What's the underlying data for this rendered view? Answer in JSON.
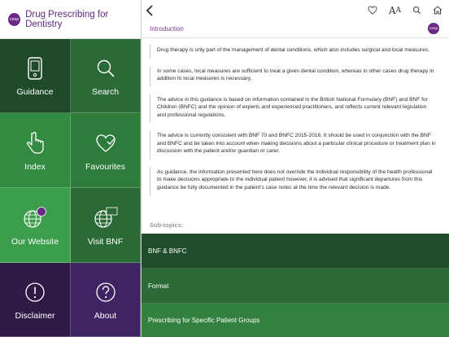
{
  "app": {
    "logo_text": "cesp",
    "title": "Drug Prescribing for Dentistry"
  },
  "tiles": [
    {
      "label": "Guidance",
      "icon": "phone-icon"
    },
    {
      "label": "Search",
      "icon": "search-icon"
    },
    {
      "label": "Index",
      "icon": "pointing-hand-icon"
    },
    {
      "label": "Favourites",
      "icon": "heart-icon"
    },
    {
      "label": "Our Website",
      "icon": "globe-icon"
    },
    {
      "label": "Visit BNF",
      "icon": "bnf-globe-icon"
    },
    {
      "label": "Disclaimer",
      "icon": "exclamation-icon"
    },
    {
      "label": "About",
      "icon": "question-icon"
    }
  ],
  "toolbar": {
    "font_size_big": "A",
    "font_size_small": "A"
  },
  "section": {
    "title": "Introduction",
    "logo_text": "cesp"
  },
  "paragraphs": [
    "Drug therapy is only part of the management of dental conditions, which also includes surgical and local measures.",
    "In some cases, local measures are sufficient to treat a given dental condition, whereas in other cases drug therapy in addition to local measures is necessary.",
    "The advice in this guidance is based on information contained in the British National Formulary (BNF) and BNF for Children (BNFC) and the opinion of experts and experienced practitioners, and reflects current relevant legislation and professional regulations.",
    "The advice is currently consistent with BNF 70 and BNFC 2015-2016. It should be used in conjunction with the BNF and BNFC and be taken into account when making decisions about a particular clinical procedure or treatment plan in discussion with the patient and/or guardian or carer.",
    "As guidance, the information presented here does not override the individual responsibility of the health professional to make decisions appropriate to the individual patient however, it is advised that significant departures from this guidance be fully documented in the patient's case notes at the time the relevant decision is made."
  ],
  "subtopics": {
    "label": "Sub-topics:",
    "items": [
      "BNF & BNFC",
      "Format",
      "Prescribing for Specific Patient Groups"
    ]
  }
}
